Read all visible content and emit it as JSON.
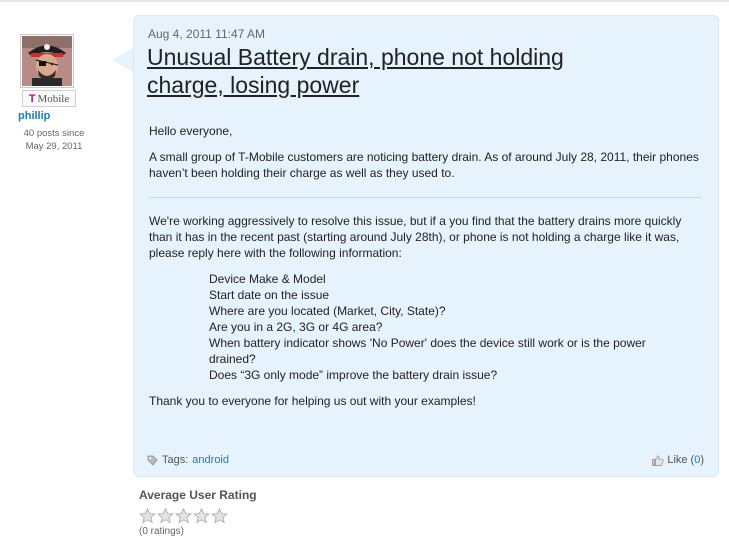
{
  "author": {
    "carrier_logo": "T",
    "carrier_name": "Mobile",
    "name": "phillip",
    "posts": "40 posts since",
    "since": "May 29, 2011",
    "avatar_icon": "pirate-avatar"
  },
  "post": {
    "date": "Aug 4, 2011 11:47 AM",
    "title": "Unusual Battery drain, phone not holding charge, losing power",
    "greeting": "Hello everyone,",
    "intro": "A small group of T-Mobile customers are noticing battery drain.  As of around July 28, 2011, their phones haven’t been holding their charge as well as they used to.",
    "working": "We're working aggressively to resolve this issue, but if a you find that the battery drains more quickly than it has in the recent past (starting around July 28th), or phone is not holding a charge like it was, please reply here with the following information:",
    "requests": [
      "Device Make & Model",
      "Start date on the issue",
      "Where are you located (Market, City, State)?",
      "Are you in a 2G, 3G or 4G area?",
      "When battery indicator shows 'No Power' does the device still work or is the power drained?",
      "Does “3G only mode” improve the battery drain issue?"
    ],
    "thanks": "Thank you to everyone for helping us out with your examples!",
    "tags_label": "Tags:",
    "tag": "android",
    "like_label": "Like",
    "like_open": "(",
    "like_count": "0",
    "like_close": ")"
  },
  "rating": {
    "heading": "Average User Rating",
    "value": 0,
    "max": 5,
    "count_text": "(0 ratings)"
  },
  "colors": {
    "bubble": "#e6f2fc",
    "link": "#1a7fb5",
    "carrier_magenta": "#e20074"
  }
}
